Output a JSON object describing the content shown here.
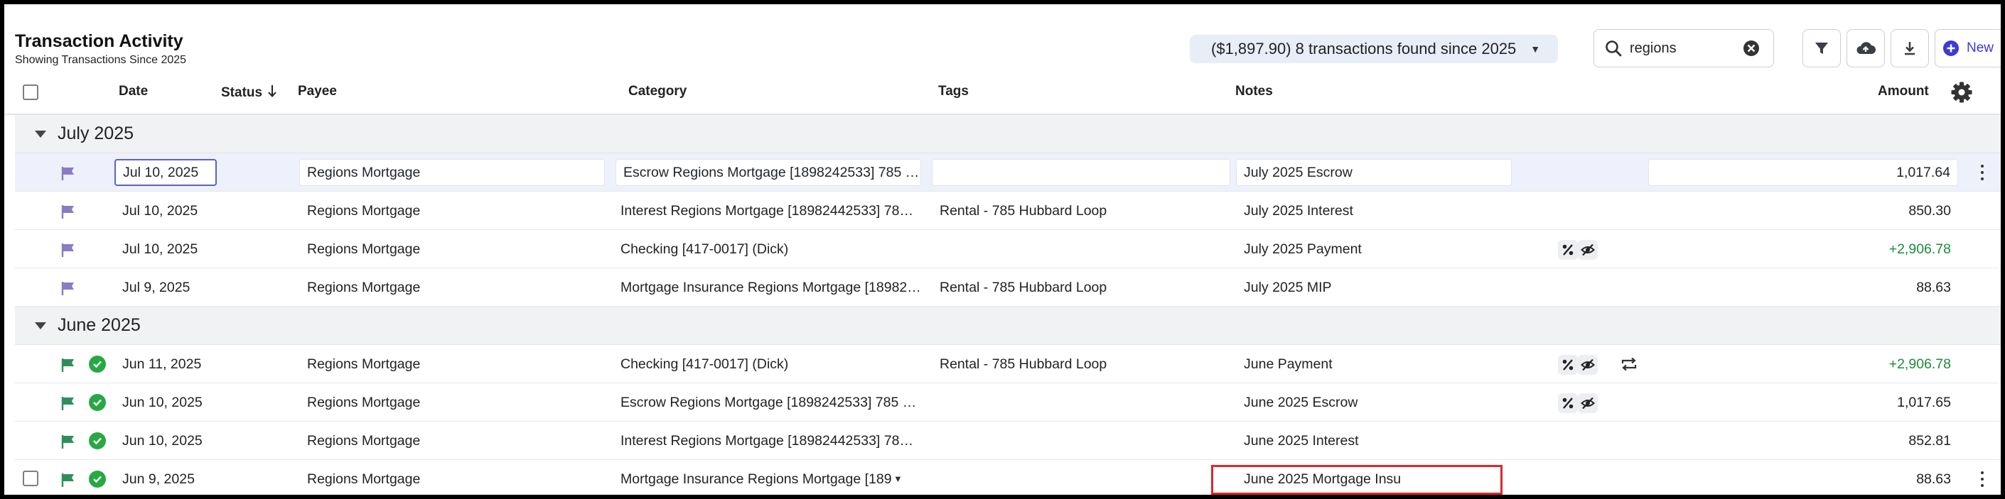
{
  "header": {
    "title": "Transaction Activity",
    "subtitle": "Showing Transactions Since 2025",
    "summary": "($1,897.90) 8 transactions found since 2025",
    "search_value": "regions",
    "new_label": "New"
  },
  "columns": {
    "date": "Date",
    "status": "Status",
    "payee": "Payee",
    "category": "Category",
    "tags": "Tags",
    "notes": "Notes",
    "amount": "Amount"
  },
  "groups": [
    {
      "label": "July 2025"
    },
    {
      "label": "June 2025"
    }
  ],
  "rows": [
    {
      "date": "Jul 10, 2025",
      "payee": "Regions Mortgage",
      "category": "Escrow Regions Mortgage [1898242533] 785 …",
      "tags": "",
      "notes": "July 2025 Escrow",
      "amount": "1,017.64",
      "positive": false,
      "cleared": false,
      "selected": true
    },
    {
      "date": "Jul 10, 2025",
      "payee": "Regions Mortgage",
      "category": "Interest Regions Mortgage [18982442533] 78…",
      "tags": "Rental - 785 Hubbard Loop",
      "notes": "July 2025 Interest",
      "amount": "850.30",
      "positive": false,
      "cleared": false
    },
    {
      "date": "Jul 10, 2025",
      "payee": "Regions Mortgage",
      "category": "Checking [417-0017] (Dick)",
      "tags": "",
      "notes": "July 2025 Payment",
      "amount": "+2,906.78",
      "positive": true,
      "cleared": false
    },
    {
      "date": "Jul 9, 2025",
      "payee": "Regions Mortgage",
      "category": "Mortgage Insurance Regions Mortgage [18982…",
      "tags": "Rental - 785 Hubbard Loop",
      "notes": "July 2025 MIP",
      "amount": "88.63",
      "positive": false,
      "cleared": false
    },
    {
      "date": "Jun 11, 2025",
      "payee": "Regions Mortgage",
      "category": "Checking [417-0017] (Dick)",
      "tags": "Rental - 785 Hubbard Loop",
      "notes": "June Payment",
      "amount": "+2,906.78",
      "positive": true,
      "cleared": true
    },
    {
      "date": "Jun 10, 2025",
      "payee": "Regions Mortgage",
      "category": "Escrow Regions Mortgage [1898242533] 785 …",
      "tags": "",
      "notes": "June 2025 Escrow",
      "amount": "1,017.65",
      "positive": false,
      "cleared": true
    },
    {
      "date": "Jun 10, 2025",
      "payee": "Regions Mortgage",
      "category": "Interest Regions Mortgage [18982442533] 78…",
      "tags": "",
      "notes": "June 2025 Interest",
      "amount": "852.81",
      "positive": false,
      "cleared": true
    },
    {
      "date": "Jun 9, 2025",
      "payee": "Regions Mortgage",
      "category": "Mortgage Insurance Regions Mortgage [189",
      "tags": "",
      "notes": "June 2025 Mortgage Insu",
      "amount": "88.63",
      "positive": false,
      "cleared": true
    }
  ],
  "colors": {
    "accent": "#3b3bd6",
    "flag": "#8b7bc4",
    "flag_cleared": "#2f8f5b",
    "cleared": "#27a844",
    "positive": "#1f8a3b",
    "highlight": "#e0262b"
  },
  "icons": {
    "search": "search-icon",
    "clear": "clear-search-icon",
    "filter": "filter-icon",
    "upload": "cloud-upload-icon",
    "download": "download-icon",
    "add": "plus-circle-icon",
    "settings": "gear-icon",
    "flag": "flag-icon",
    "cleared": "check-circle-icon",
    "hidden": "eye-off-icon",
    "split": "percent-icon",
    "recurring": "repeat-icon",
    "more": "kebab-icon"
  }
}
